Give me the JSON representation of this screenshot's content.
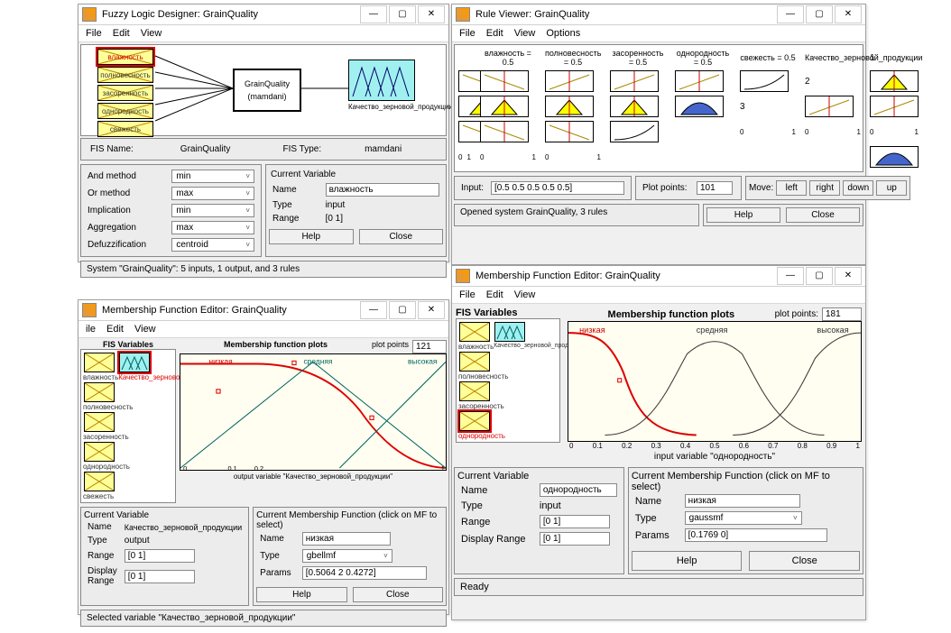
{
  "fd": {
    "title": "Fuzzy Logic Designer: GrainQuality",
    "menus": [
      "File",
      "Edit",
      "View"
    ],
    "inputs": [
      "влажность",
      "полновесность",
      "засоренность",
      "однородность",
      "свежесть"
    ],
    "system": "GrainQuality",
    "system_sub": "(mamdani)",
    "output": "Качество_зерновой_продукции",
    "fis_name_label": "FIS Name:",
    "fis_name": "GrainQuality",
    "fis_type_label": "FIS Type:",
    "fis_type": "mamdani",
    "rows": [
      {
        "k": "And method",
        "v": "min"
      },
      {
        "k": "Or method",
        "v": "max"
      },
      {
        "k": "Implication",
        "v": "min"
      },
      {
        "k": "Aggregation",
        "v": "max"
      },
      {
        "k": "Defuzzification",
        "v": "centroid"
      }
    ],
    "cv_header": "Current Variable",
    "cv_name_label": "Name",
    "cv_name": "влажность",
    "cv_type_label": "Type",
    "cv_type": "input",
    "cv_range_label": "Range",
    "cv_range": "[0 1]",
    "help": "Help",
    "close": "Close",
    "status": "System \"GrainQuality\": 5 inputs, 1 output, and 3 rules"
  },
  "rv": {
    "title": "Rule Viewer: GrainQuality",
    "menus": [
      "File",
      "Edit",
      "View",
      "Options"
    ],
    "col_hdrs": [
      "влажность = 0.5",
      "полновесность = 0.5",
      "засоренность = 0.5",
      "однородность = 0.5",
      "свежесть = 0.5",
      "Качество_зерновой_продукции"
    ],
    "row_labels": [
      "1",
      "2",
      "3"
    ],
    "axis_ticks": [
      "0",
      "1"
    ],
    "input_label": "Input:",
    "input_value": "[0.5 0.5 0.5 0.5 0.5]",
    "plot_points_label": "Plot points:",
    "plot_points": "101",
    "move_label": "Move:",
    "move_btns": [
      "left",
      "right",
      "down",
      "up"
    ],
    "status": "Opened system GrainQuality, 3 rules",
    "help": "Help",
    "close": "Close"
  },
  "mf1": {
    "title": "Membership Function Editor: GrainQuality",
    "menus": [
      "ile",
      "Edit",
      "View"
    ],
    "fis_vars_label": "FIS Variables",
    "plot_title": "Membership function plots",
    "plot_points_label": "plot points",
    "plot_points": "121",
    "var_labels": [
      "влажность",
      "Качество_зерновой_продукции",
      "полновесность",
      "засоренность",
      "однородность",
      "свежесть"
    ],
    "mf_labels": [
      "низкая",
      "средняя",
      "высокая"
    ],
    "xcaption": "output variable \"Качество_зерновой_продукции\"",
    "cv_header": "Current Variable",
    "cv_name_label": "Name",
    "cv_name": "Качество_зерновой_продукции",
    "cv_type_label": "Type",
    "cv_type": "output",
    "cv_range_label": "Range",
    "cv_range": "[0 1]",
    "cv_drange_label": "Display Range",
    "cv_drange": "[0 1]",
    "cmf_header": "Current Membership Function (click on MF to select)",
    "cmf_name_label": "Name",
    "cmf_name": "низкая",
    "cmf_type_label": "Type",
    "cmf_type": "gbellmf",
    "cmf_params_label": "Params",
    "cmf_params": "[0.5064 2 0.4272]",
    "help": "Help",
    "close": "Close",
    "status": "Selected variable \"Качество_зерновой_продукции\""
  },
  "mf2": {
    "title": "Membership Function Editor: GrainQuality",
    "menus": [
      "File",
      "Edit",
      "View"
    ],
    "fis_vars_label": "FIS Variables",
    "plot_title": "Membership function plots",
    "plot_points_label": "plot points:",
    "plot_points": "181",
    "var_labels": [
      "влажность",
      "Качество_зерновой_продукции",
      "полновесность",
      "засоренность",
      "однородность"
    ],
    "mf_labels": [
      "низкая",
      "средняя",
      "высокая"
    ],
    "xcaption": "input variable \"однородность\"",
    "xticks": [
      "0",
      "0.1",
      "0.2",
      "0.3",
      "0.4",
      "0.5",
      "0.6",
      "0.7",
      "0.8",
      "0.9",
      "1"
    ],
    "cv_header": "Current Variable",
    "cv_name_label": "Name",
    "cv_name": "однородность",
    "cv_type_label": "Type",
    "cv_type": "input",
    "cv_range_label": "Range",
    "cv_range": "[0 1]",
    "cv_drange_label": "Display Range",
    "cv_drange": "[0 1]",
    "cmf_header": "Current Membership Function (click on MF to select)",
    "cmf_name_label": "Name",
    "cmf_name": "низкая",
    "cmf_type_label": "Type",
    "cmf_type": "gaussmf",
    "cmf_params_label": "Params",
    "cmf_params": "[0.1769 0]",
    "help": "Help",
    "close": "Close",
    "ready": "Ready"
  },
  "chart_data": [
    {
      "type": "line",
      "window": "mf1",
      "title": "Membership function plots",
      "xlim": [
        0,
        1
      ],
      "ylim": [
        0,
        1
      ],
      "series": [
        {
          "name": "низкая",
          "kind": "gbellmf",
          "params": [
            0.5064,
            2,
            0.4272
          ]
        },
        {
          "name": "средняя",
          "kind": "trimf",
          "params": [
            0,
            0.5,
            1
          ]
        },
        {
          "name": "высокая",
          "kind": "trimf",
          "params": [
            0.6,
            1,
            1.4
          ]
        }
      ],
      "xlabel": "output variable \"Качество_зерновой_продукции\""
    },
    {
      "type": "line",
      "window": "mf2",
      "title": "Membership function plots",
      "xlim": [
        0,
        1
      ],
      "ylim": [
        0,
        1
      ],
      "series": [
        {
          "name": "низкая",
          "kind": "gaussmf",
          "params": [
            0.1769,
            0
          ]
        },
        {
          "name": "средняя",
          "kind": "gaussmf",
          "params": [
            0.18,
            0.5
          ]
        },
        {
          "name": "высокая",
          "kind": "gaussmf",
          "params": [
            0.18,
            1
          ]
        }
      ],
      "xlabel": "input variable \"однородность\""
    }
  ]
}
